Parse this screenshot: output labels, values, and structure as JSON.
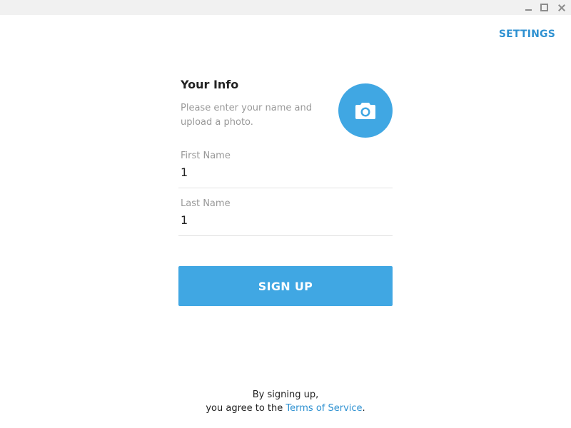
{
  "window": {
    "controls": {
      "minimize_icon": "minimize-icon",
      "maximize_icon": "maximize-icon",
      "close_icon": "close-icon"
    }
  },
  "header": {
    "settings_label": "SETTINGS"
  },
  "info": {
    "title": "Your Info",
    "description": "Please enter your name and upload a photo.",
    "photo_icon": "camera-icon"
  },
  "form": {
    "first_name": {
      "label": "First Name",
      "value": "1"
    },
    "last_name": {
      "label": "Last Name",
      "value": "1"
    },
    "submit_label": "SIGN UP"
  },
  "footer": {
    "line1": "By signing up,",
    "line2_prefix": "you agree to the ",
    "terms_link": "Terms of Service",
    "line2_suffix": "."
  },
  "colors": {
    "accent": "#40a7e3",
    "link": "#2e91d1",
    "muted_text": "#999999",
    "titlebar": "#f1f1f1"
  }
}
